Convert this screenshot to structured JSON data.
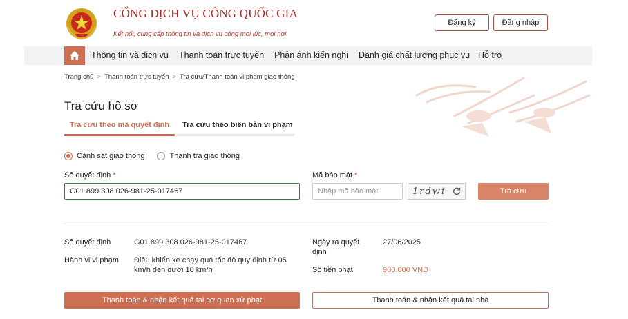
{
  "header": {
    "title": "CỔNG DỊCH VỤ CÔNG QUỐC GIA",
    "subtitle": "Kết nối, cung cấp thông tin và dịch vụ công mọi lúc, mọi nơi",
    "register_label": "Đăng ký",
    "login_label": "Đăng nhập"
  },
  "nav": {
    "home_icon": "home-icon",
    "items": [
      {
        "label": "Thông tin và dịch vụ"
      },
      {
        "label": "Thanh toán trực tuyến"
      },
      {
        "label": "Phản ánh kiến nghị"
      },
      {
        "label": "Đánh giá chất lượng phục vụ"
      },
      {
        "label": "Hỗ trợ"
      }
    ]
  },
  "breadcrumb": [
    "Trang chủ",
    "Thanh toán trực tuyến",
    "Tra cứu/Thanh toán vi phạm giao thông"
  ],
  "page": {
    "title": "Tra cứu hồ sơ",
    "tabs": [
      {
        "label": "Tra cứu theo mã quyết định",
        "active": true
      },
      {
        "label": "Tra cứu theo biên bản vi phạm",
        "active": false
      }
    ]
  },
  "form": {
    "radios": [
      {
        "label": "Cảnh sát giao thông",
        "selected": true
      },
      {
        "label": "Thanh tra giao thông",
        "selected": false
      }
    ],
    "decision_label": "Số quyết định",
    "decision_value": "G01.899.308.026-981-25-017467",
    "captcha_label": "Mã bảo mật",
    "captcha_placeholder": "Nhập mã bảo mật",
    "captcha_image_text": "1rdwi",
    "required_mark": "*",
    "search_label": "Tra cứu"
  },
  "result": {
    "decision_number_label": "Số quyết định",
    "decision_number_value": "G01.899.308.026-981-25-017467",
    "violation_label": "Hành vi vi phạm",
    "violation_value_line1": "Điều khiển xe chạy quá tốc độ quy định từ 05",
    "violation_value_line2": "km/h đến dưới 10 km/h",
    "date_label_line1": "Ngày ra quyết",
    "date_label_line2": "định",
    "date_value": "27/06/2025",
    "fine_label": "Số tiền phạt",
    "fine_value": "900.000 VND"
  },
  "actions": {
    "pay_office_label": "Thanh toán & nhận kết quả tại cơ quan xử phạt",
    "pay_home_label": "Thanh toán & nhận kết quả tại nhà"
  },
  "colors": {
    "accent": "#cd6f52",
    "brand_red": "#b0261f",
    "money": "#d0704f"
  }
}
